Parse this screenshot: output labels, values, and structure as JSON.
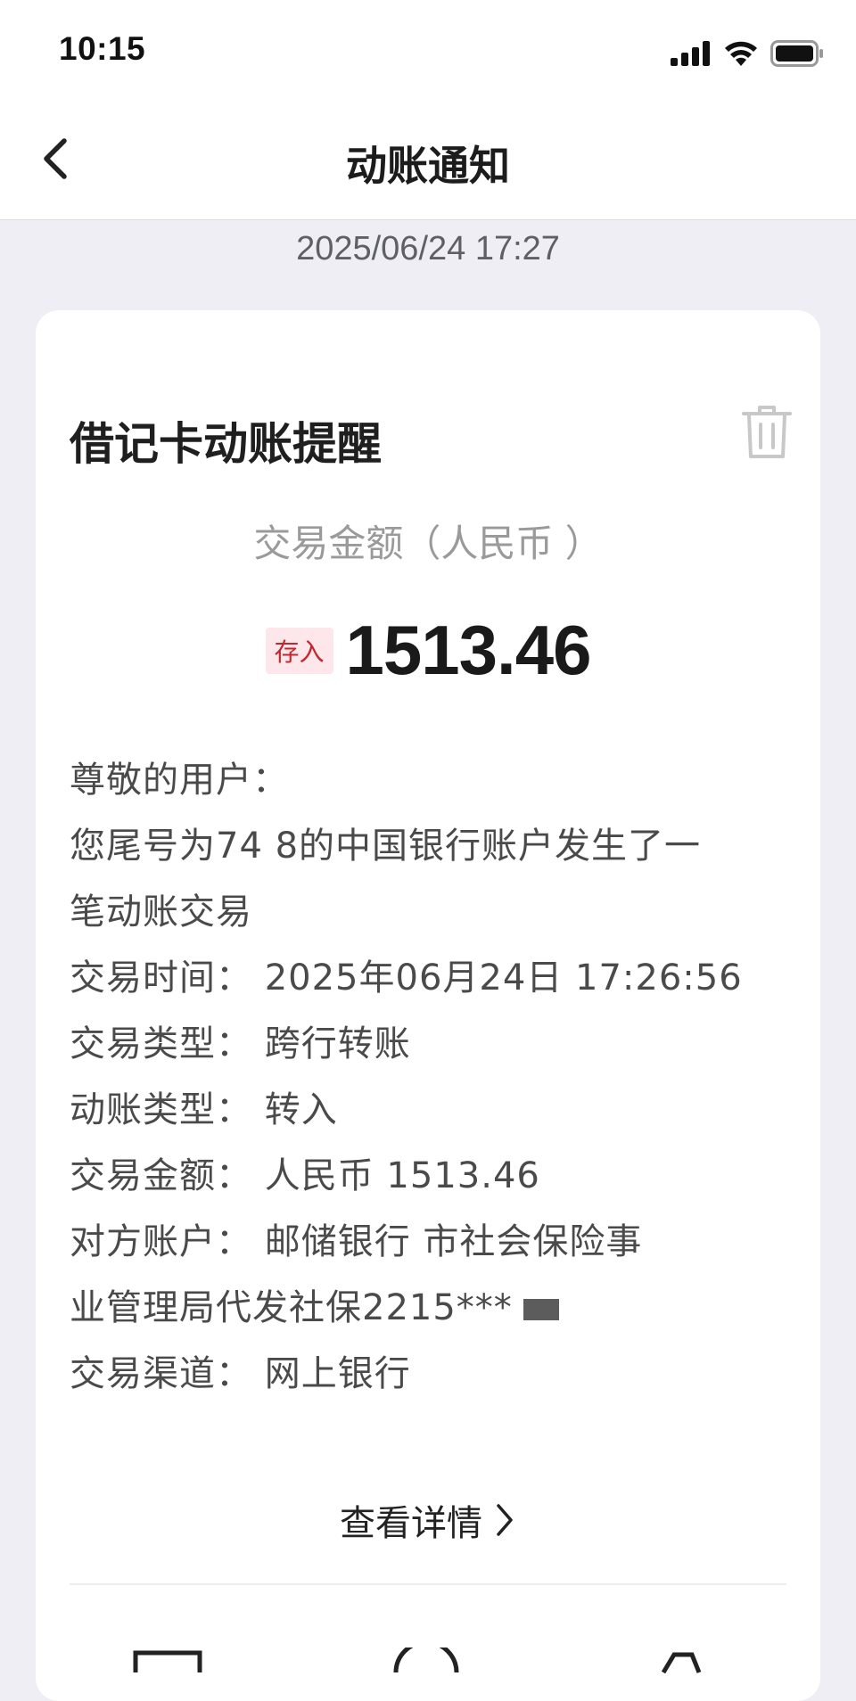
{
  "status_bar": {
    "time": "10:15"
  },
  "nav": {
    "title": "动账通知"
  },
  "message": {
    "date": "2025/06/24 17:27",
    "card_title": "借记卡动账提醒",
    "amount_label": "交易金额（人民币 ）",
    "badge": "存入",
    "amount": "1513.46",
    "lines": [
      "尊敬的用户：",
      "您尾号为74   8的中国银行账户发生了一",
      "笔动账交易",
      "交易时间：  2025年06月24日 17:26:56",
      "交易类型：  跨行转账",
      "动账类型：  转入",
      "交易金额：  人民币 1513.46",
      "对方账户：  邮储银行    市社会保险事",
      "业管理局代发社保2215***",
      "交易渠道：  网上银行"
    ],
    "details_label": "查看详情"
  },
  "colors": {
    "background": "#efeef4",
    "badge_bg": "#fde7ea",
    "badge_text": "#c4262e"
  },
  "icons": [
    "chevron-left-icon",
    "trash-icon",
    "chevron-right-icon",
    "signal-icon",
    "wifi-icon",
    "battery-icon"
  ]
}
